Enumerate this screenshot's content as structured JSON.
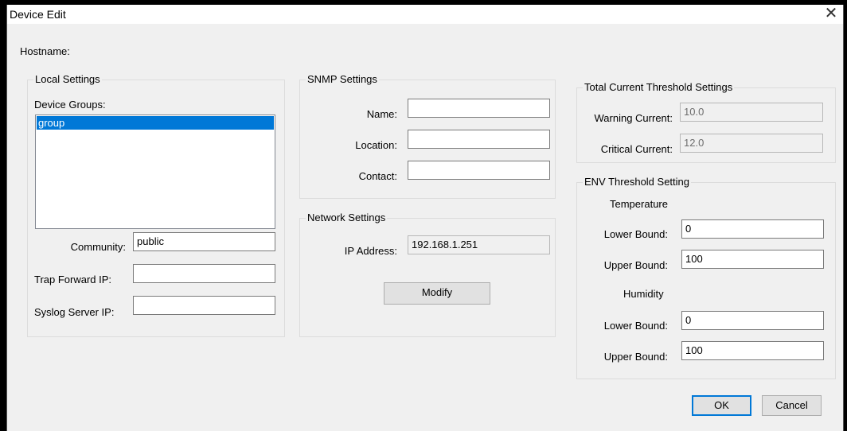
{
  "window": {
    "title": "Device Edit"
  },
  "hostname_label": "Hostname:",
  "local_settings": {
    "legend": "Local Settings",
    "device_groups_label": "Device Groups:",
    "groups": [
      "group"
    ],
    "community_label": "Community:",
    "community_value": "public",
    "trap_forward_label": "Trap Forward IP:",
    "trap_forward_value": "",
    "syslog_label": "Syslog Server IP:",
    "syslog_value": ""
  },
  "snmp_settings": {
    "legend": "SNMP Settings",
    "name_label": "Name:",
    "name_value": "",
    "location_label": "Location:",
    "location_value": "",
    "contact_label": "Contact:",
    "contact_value": ""
  },
  "network_settings": {
    "legend": "Network Settings",
    "ip_label": "IP Address:",
    "ip_value": "192.168.1.251",
    "modify_label": "Modify"
  },
  "total_current": {
    "legend": "Total Current Threshold Settings",
    "warning_label": "Warning Current:",
    "warning_value": "10.0",
    "critical_label": "Critical Current:",
    "critical_value": "12.0"
  },
  "env_threshold": {
    "legend": "ENV Threshold Setting",
    "temperature_label": "Temperature",
    "temp_lower_label": "Lower Bound:",
    "temp_lower_value": "0",
    "temp_upper_label": "Upper Bound:",
    "temp_upper_value": "100",
    "humidity_label": "Humidity",
    "hum_lower_label": "Lower Bound:",
    "hum_lower_value": "0",
    "hum_upper_label": "Upper Bound:",
    "hum_upper_value": "100"
  },
  "buttons": {
    "ok_label": "OK",
    "cancel_label": "Cancel"
  },
  "colors": {
    "selection": "#0078d7",
    "dialog_bg": "#f0f0f0"
  }
}
